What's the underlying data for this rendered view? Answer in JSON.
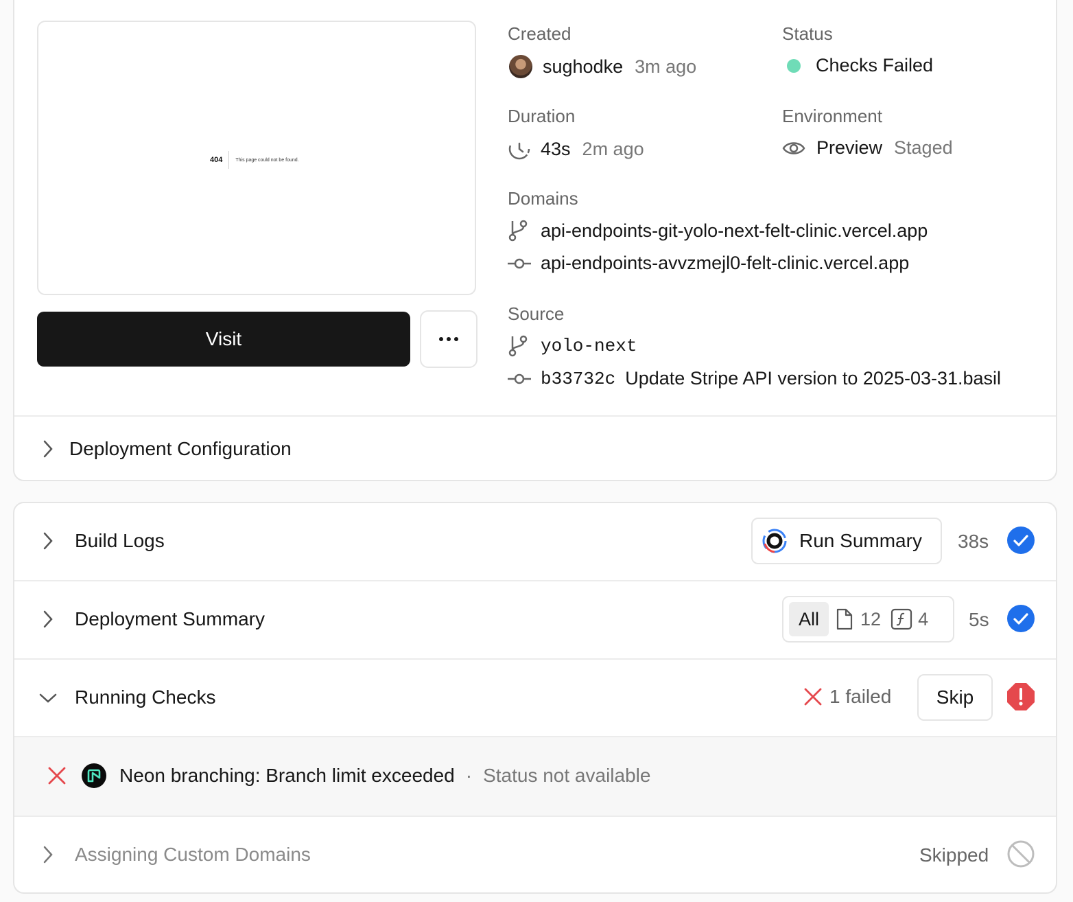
{
  "preview": {
    "error_code": "404",
    "error_message": "This page could not be found."
  },
  "actions": {
    "visit_label": "Visit"
  },
  "details": {
    "created": {
      "label": "Created",
      "user": "sughodke",
      "time": "3m ago"
    },
    "status": {
      "label": "Status",
      "value": "Checks Failed",
      "color": "#6fdcb7"
    },
    "duration": {
      "label": "Duration",
      "value": "43s",
      "time": "2m ago"
    },
    "environment": {
      "label": "Environment",
      "value": "Preview",
      "state": "Staged"
    },
    "domains": {
      "label": "Domains",
      "items": [
        "api-endpoints-git-yolo-next-felt-clinic.vercel.app",
        "api-endpoints-avvzmejl0-felt-clinic.vercel.app"
      ]
    },
    "source": {
      "label": "Source",
      "branch": "yolo-next",
      "commit_hash": "b33732c",
      "commit_message": "Update Stripe API version to 2025-03-31.basil"
    }
  },
  "sections": {
    "deployment_configuration": "Deployment Configuration",
    "build_logs": {
      "title": "Build Logs",
      "run_summary": "Run Summary",
      "time": "38s"
    },
    "deployment_summary": {
      "title": "Deployment Summary",
      "filter_all": "All",
      "files_count": "12",
      "functions_count": "4",
      "time": "5s"
    },
    "running_checks": {
      "title": "Running Checks",
      "failed": "1 failed",
      "skip_label": "Skip"
    },
    "check_item": {
      "name": "Neon branching: Branch limit exceeded",
      "separator": "·",
      "status": "Status not available"
    },
    "custom_domains": {
      "title": "Assigning Custom Domains",
      "status": "Skipped"
    }
  },
  "colors": {
    "success_blue": "#1f6feb",
    "error_red": "#e5484d"
  }
}
